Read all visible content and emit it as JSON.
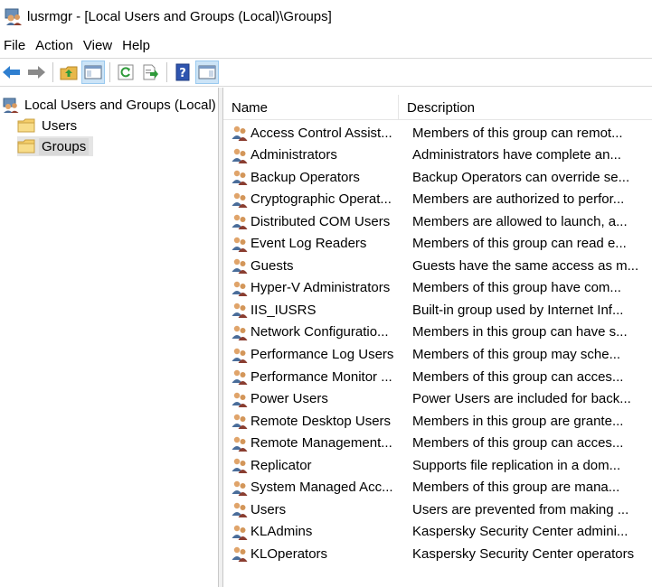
{
  "window": {
    "title": "lusrmgr - [Local Users and Groups (Local)\\Groups]"
  },
  "menu": [
    "File",
    "Action",
    "View",
    "Help"
  ],
  "toolbar": {
    "buttons": [
      {
        "name": "back-arrow-icon"
      },
      {
        "name": "forward-arrow-icon"
      },
      {
        "name": "up-folder-icon"
      },
      {
        "name": "show-hide-console-tree-icon"
      },
      {
        "name": "refresh-icon"
      },
      {
        "name": "export-list-icon"
      },
      {
        "name": "help-icon"
      },
      {
        "name": "show-hide-action-pane-icon"
      }
    ]
  },
  "tree": {
    "root": "Local Users and Groups (Local)",
    "children": [
      "Users",
      "Groups"
    ],
    "selected": "Groups"
  },
  "list": {
    "columns": [
      "Name",
      "Description"
    ],
    "rows": [
      {
        "name": "Access Control Assist...",
        "desc": "Members of this group can remot..."
      },
      {
        "name": "Administrators",
        "desc": "Administrators have complete an..."
      },
      {
        "name": "Backup Operators",
        "desc": "Backup Operators can override se..."
      },
      {
        "name": "Cryptographic Operat...",
        "desc": "Members are authorized to perfor..."
      },
      {
        "name": "Distributed COM Users",
        "desc": "Members are allowed to launch, a..."
      },
      {
        "name": "Event Log Readers",
        "desc": "Members of this group can read e..."
      },
      {
        "name": "Guests",
        "desc": "Guests have the same access as m..."
      },
      {
        "name": "Hyper-V Administrators",
        "desc": "Members of this group have com..."
      },
      {
        "name": "IIS_IUSRS",
        "desc": "Built-in group used by Internet Inf..."
      },
      {
        "name": "Network Configuratio...",
        "desc": "Members in this group can have s..."
      },
      {
        "name": "Performance Log Users",
        "desc": "Members of this group may sche..."
      },
      {
        "name": "Performance Monitor ...",
        "desc": "Members of this group can acces..."
      },
      {
        "name": "Power Users",
        "desc": "Power Users are included for back..."
      },
      {
        "name": "Remote Desktop Users",
        "desc": "Members in this group are grante..."
      },
      {
        "name": "Remote Management...",
        "desc": "Members of this group can acces..."
      },
      {
        "name": "Replicator",
        "desc": "Supports file replication in a dom..."
      },
      {
        "name": "System Managed Acc...",
        "desc": "Members of this group are mana..."
      },
      {
        "name": "Users",
        "desc": "Users are prevented from making ..."
      },
      {
        "name": "KLAdmins",
        "desc": "Kaspersky Security Center admini..."
      },
      {
        "name": "KLOperators",
        "desc": "Kaspersky Security Center operators"
      }
    ]
  },
  "colors": {
    "selected_row": "#d9d9d9",
    "pressed_button": "#cce4f7",
    "folder": "#f5cf6a"
  }
}
